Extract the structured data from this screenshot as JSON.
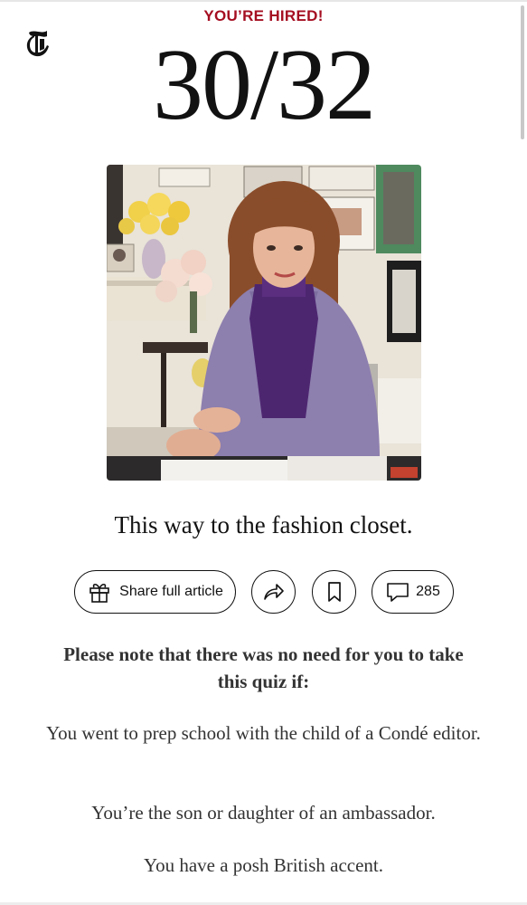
{
  "header": {
    "logo_name": "nyt-t-logo",
    "kicker": "YOU’RE HIRED!",
    "score": "30/32"
  },
  "photo": {
    "subject": "woman-at-desk-photo",
    "colors": {
      "wall": "#e9e3d8",
      "jacket": "#8d7fae",
      "sweater": "#4d2670",
      "hair": "#8a4d2b",
      "flowers": "#f1d04a"
    }
  },
  "caption": "This way to the fashion closet.",
  "actions": {
    "share_full_label": "Share full article",
    "comments_count": "285",
    "icons": [
      "gift-icon",
      "share-arrow-icon",
      "bookmark-icon",
      "comment-icon"
    ]
  },
  "note": {
    "heading": "Please note that there was no need for you to take this quiz if:",
    "items": [
      "You went to prep school with the child of a Condé editor.",
      "You’re the son or daughter of an ambassador.",
      "You have a posh British accent."
    ]
  }
}
